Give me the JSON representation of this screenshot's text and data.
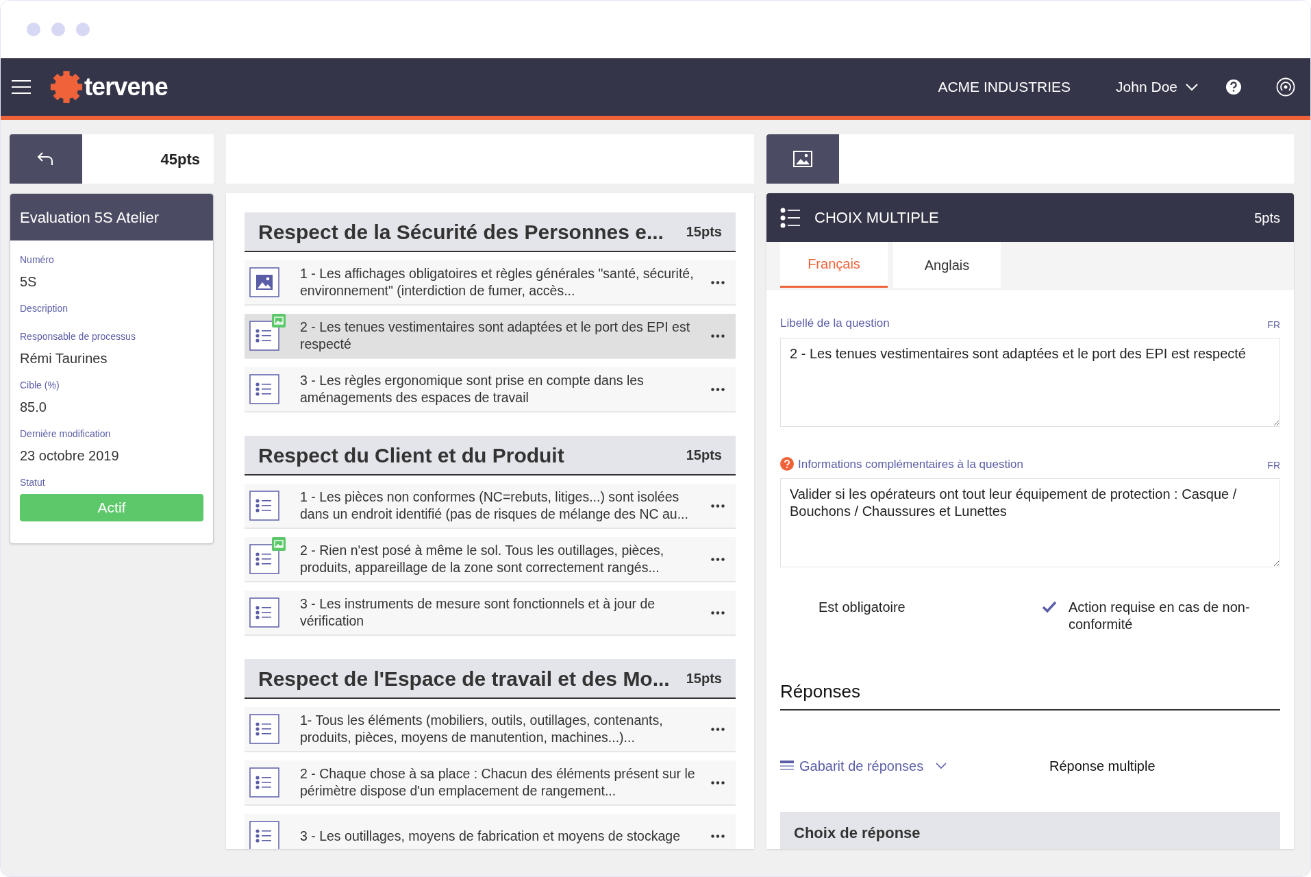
{
  "nav": {
    "logo": "tervene",
    "company": "ACME INDUSTRIES",
    "user": "John Doe"
  },
  "left": {
    "score": "45pts",
    "title": "Evaluation 5S Atelier",
    "fields": [
      {
        "label": "Numéro",
        "value": "5S"
      },
      {
        "label": "Description"
      },
      {
        "label": "Responsable de processus",
        "value": "Rémi Taurines"
      },
      {
        "label": "Cible (%)",
        "value": "85.0"
      },
      {
        "label": "Dernière modification",
        "value": "23 octobre 2019"
      }
    ],
    "status_label": "Statut",
    "status": "Actif"
  },
  "sections": [
    {
      "title": "Respect de la Sécurité des Personnes e...",
      "points": "15pts",
      "questions": [
        {
          "kind": "picture",
          "badge": false,
          "selected": false,
          "text": "1 - Les affichages obligatoires et règles générales \"santé, sécurité, environnement\" (interdiction de fumer, accès..."
        },
        {
          "kind": "choice",
          "badge": true,
          "selected": true,
          "text": "2 - Les tenues vestimentaires sont adaptées et le port des EPI est respecté"
        },
        {
          "kind": "choice",
          "badge": false,
          "selected": false,
          "text": "3 - Les règles ergonomique sont prise en compte dans les aménagements des espaces de travail"
        }
      ]
    },
    {
      "title": "Respect du Client et du Produit",
      "points": "15pts",
      "questions": [
        {
          "kind": "choice",
          "badge": false,
          "selected": false,
          "text": "1 - Les pièces non conformes (NC=rebuts, litiges...) sont isolées dans un endroit identifié (pas de risques de mélange des NC au..."
        },
        {
          "kind": "choice",
          "badge": true,
          "selected": false,
          "text": "2 - Rien n'est posé à même le sol. Tous les outillages, pièces, produits, appareillage de la zone sont correctement rangés..."
        },
        {
          "kind": "choice",
          "badge": false,
          "selected": false,
          "text": "3 - Les instruments de mesure sont fonctionnels et à jour de vérification"
        }
      ]
    },
    {
      "title": "Respect de l'Espace de travail et des Mo...",
      "points": "15pts",
      "questions": [
        {
          "kind": "choice",
          "badge": false,
          "selected": false,
          "text": "1- Tous les éléments (mobiliers, outils, outillages, contenants, produits, pièces, moyens de manutention, machines...)..."
        },
        {
          "kind": "choice",
          "badge": false,
          "selected": false,
          "text": "2 - Chaque chose à sa place : Chacun des éléments présent sur le périmètre dispose d'un emplacement de rangement..."
        },
        {
          "kind": "choice",
          "badge": false,
          "selected": false,
          "text": "3 - Les outillages, moyens de fabrication et moyens de stockage"
        }
      ]
    }
  ],
  "detail": {
    "type": "CHOIX MULTIPLE",
    "points": "5pts",
    "tabs": [
      {
        "label": "Français",
        "selected": true
      },
      {
        "label": "Anglais",
        "selected": false
      }
    ],
    "question_label": "Libellé de la question",
    "question_lang": "FR",
    "question_value": "2 - Les tenues vestimentaires sont adaptées et le port des EPI est respecté",
    "info_label": "Informations complémentaires à la question",
    "info_lang": "FR",
    "info_value": "Valider si les opérateurs ont tout leur équipement de protection : Casque / Bouchons / Chaussures et Lunettes",
    "checks": [
      {
        "label": "Est obligatoire",
        "checked": false
      },
      {
        "label": "Action requise en cas de non-conformité",
        "checked": true
      }
    ],
    "responses_title": "Réponses",
    "template_label": "Gabarit de réponses",
    "template_value": "Réponse multiple",
    "choices_title": "Choix de réponse"
  }
}
